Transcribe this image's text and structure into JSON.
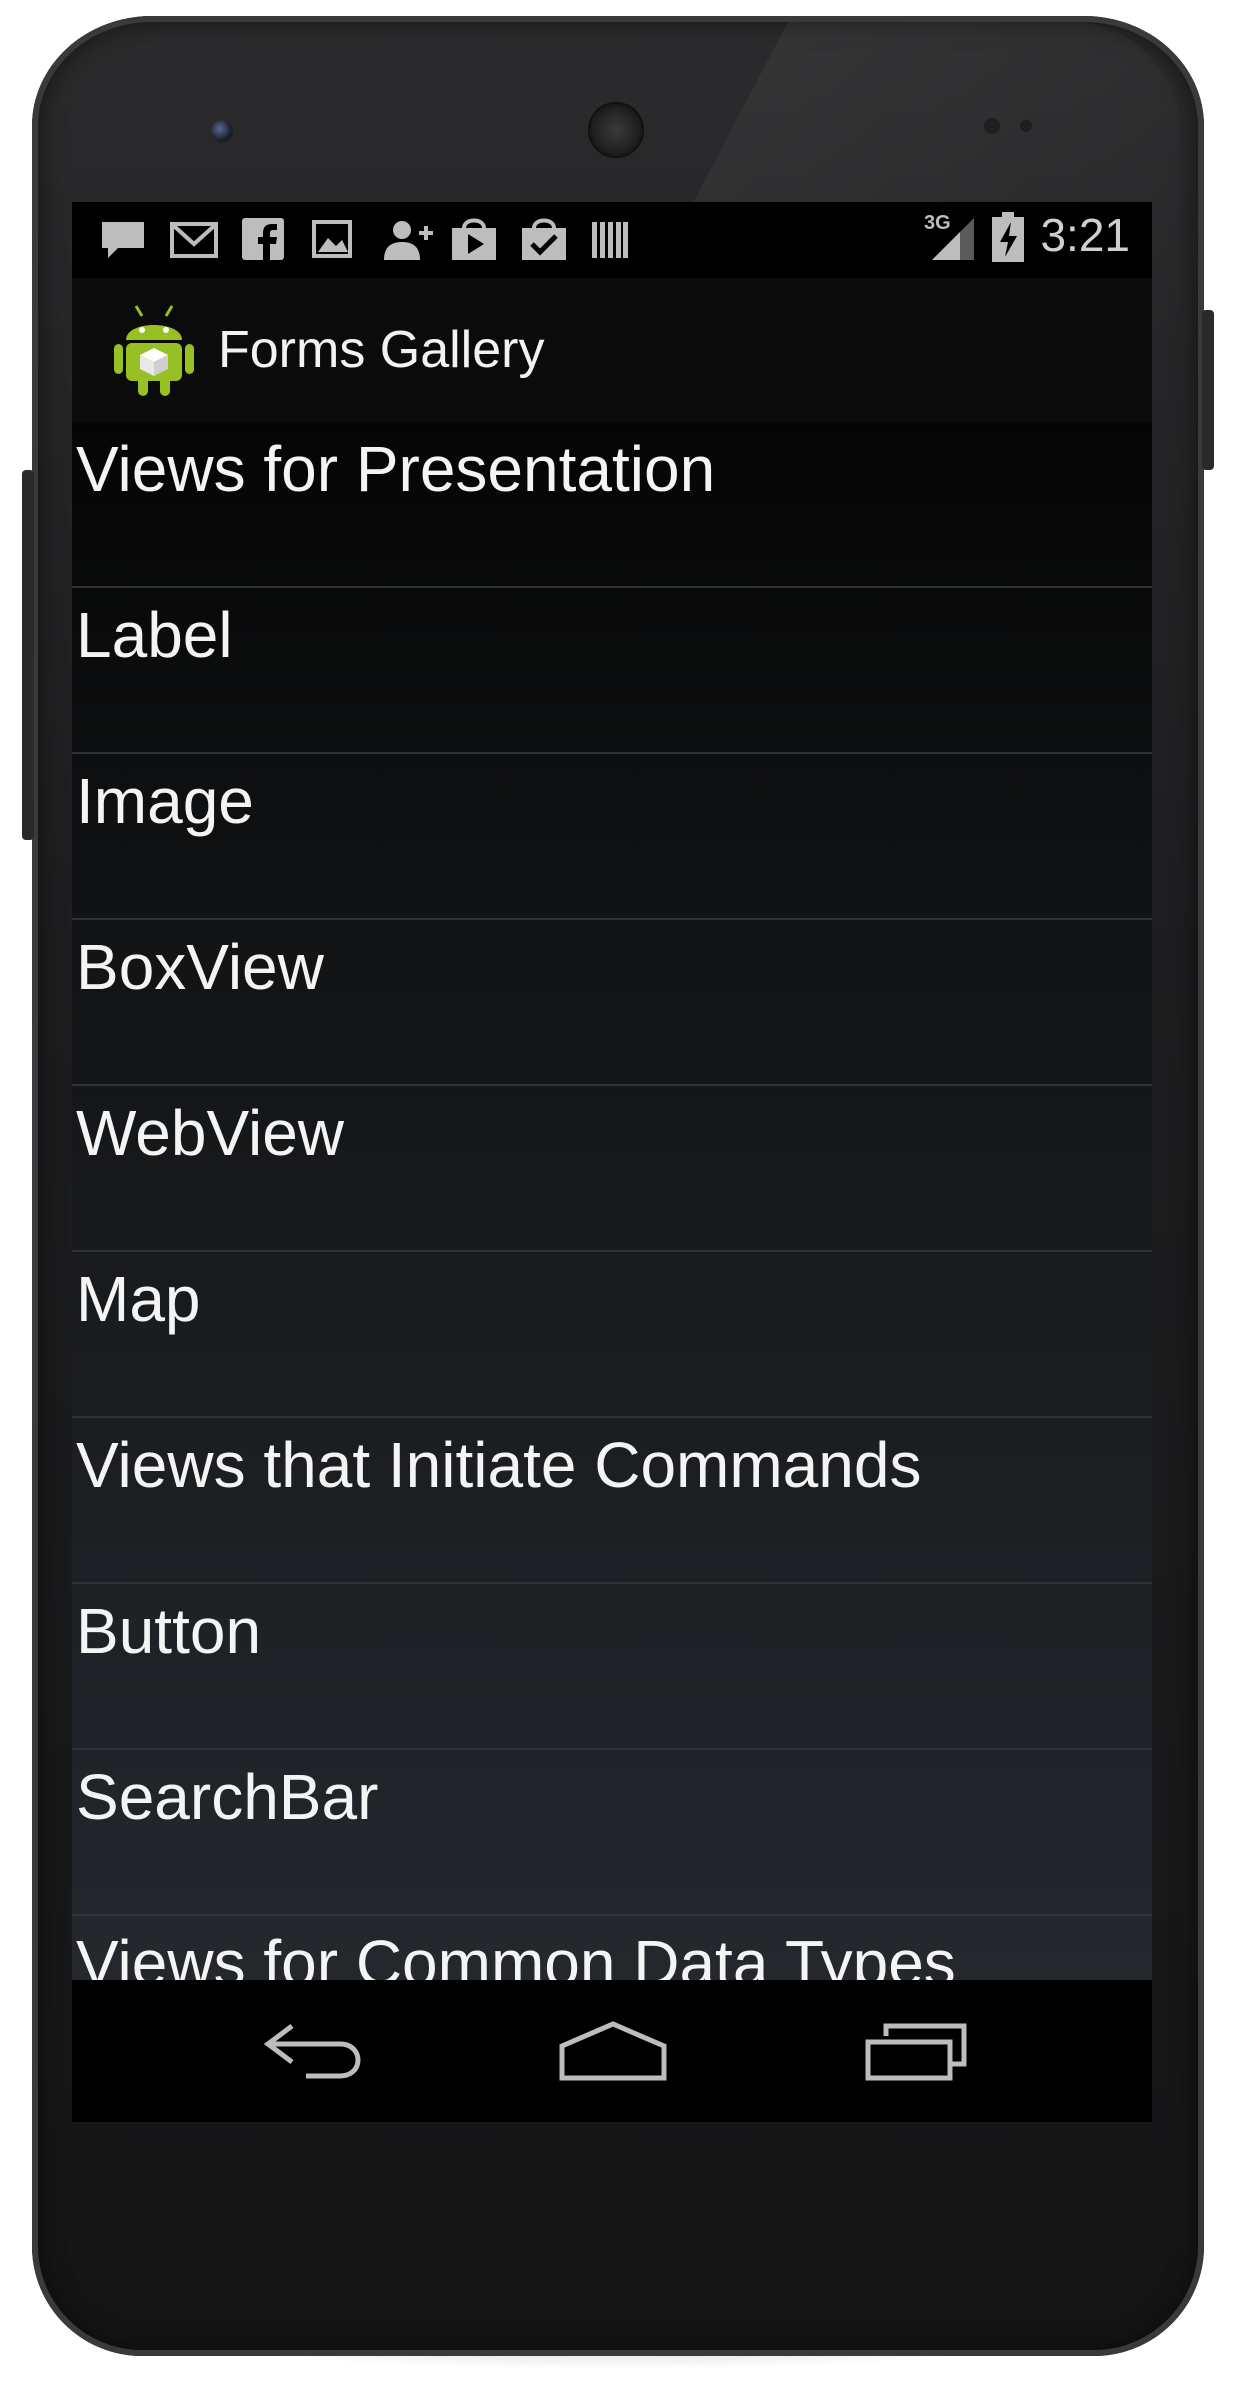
{
  "status_bar": {
    "notification_icons": [
      "chat-icon",
      "gmail-icon",
      "facebook-icon",
      "gallery-icon",
      "add-contact-icon",
      "play-store-icon",
      "store-update-icon",
      "barcode-icon"
    ],
    "network": "3G",
    "time": "3:21"
  },
  "action_bar": {
    "app_title": "Forms Gallery",
    "app_icon": "android-icon"
  },
  "list": {
    "items": [
      "Views for Presentation",
      "Label",
      "Image",
      "BoxView",
      "WebView",
      "Map",
      "Views that Initiate Commands",
      "Button",
      "SearchBar",
      "Views for Common Data Types"
    ]
  },
  "nav_bar": {
    "buttons": [
      "back-icon",
      "home-icon",
      "recents-icon"
    ]
  },
  "colors": {
    "android_green": "#97c024",
    "text": "#f4f4f4",
    "divider": "#2f3236"
  }
}
